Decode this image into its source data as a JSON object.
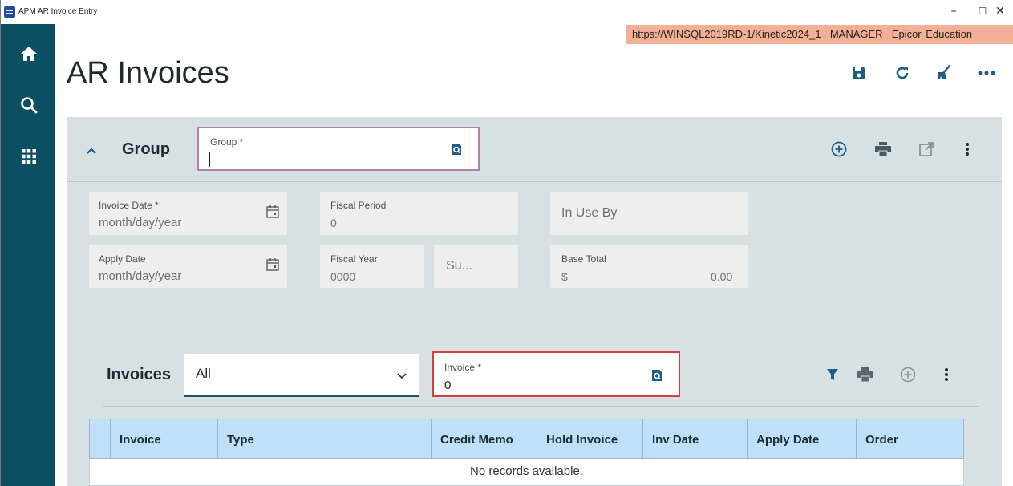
{
  "window": {
    "title": "APM AR Invoice Entry",
    "controls": {
      "minimize": "–",
      "maximize": "☐",
      "close": "✕"
    }
  },
  "sidebar": {
    "items": [
      {
        "icon": "home-icon"
      },
      {
        "icon": "search-icon"
      },
      {
        "icon": "apps-grid-icon"
      }
    ]
  },
  "info_banner": {
    "url": "https://WINSQL2019RD-1/Kinetic2024_1",
    "user": "MANAGER",
    "company": "Epicor Education"
  },
  "page": {
    "title": "AR Invoices",
    "toolbar": [
      "save-icon",
      "refresh-icon",
      "clear-icon",
      "more-icon"
    ]
  },
  "group_section": {
    "label": "Group",
    "group_field": {
      "label": "Group *",
      "value": ""
    },
    "actions": [
      "add-icon",
      "print-icon",
      "open-external-icon",
      "kebab-menu-icon"
    ],
    "invoice_date": {
      "label": "Invoice Date *",
      "placeholder": "month/day/year"
    },
    "apply_date": {
      "label": "Apply Date",
      "placeholder": "month/day/year"
    },
    "fiscal_period": {
      "label": "Fiscal Period",
      "value": "0"
    },
    "fiscal_year": {
      "label": "Fiscal Year",
      "value": "0000"
    },
    "su_field": {
      "value": "Su..."
    },
    "in_use_by": {
      "label": "In Use By"
    },
    "base_total": {
      "label": "Base Total",
      "currency": "$",
      "value": "0.00"
    }
  },
  "invoices_section": {
    "label": "Invoices",
    "filter": {
      "selected": "All"
    },
    "invoice_field": {
      "label": "Invoice *",
      "value": "0"
    },
    "actions": [
      "filter-icon",
      "print-icon",
      "add-icon",
      "kebab-menu-icon"
    ],
    "grid": {
      "columns": [
        "Invoice",
        "Type",
        "Credit Memo",
        "Hold Invoice",
        "Inv Date",
        "Apply Date",
        "Order"
      ],
      "empty_message": "No records available."
    }
  },
  "colors": {
    "sidebar": "#0c4f62",
    "banner": "#f4b095",
    "panel": "#d7e1e4",
    "accent": "#1f5c85",
    "grid_header": "#bfe0f8",
    "required_error": "#e03b3b"
  }
}
